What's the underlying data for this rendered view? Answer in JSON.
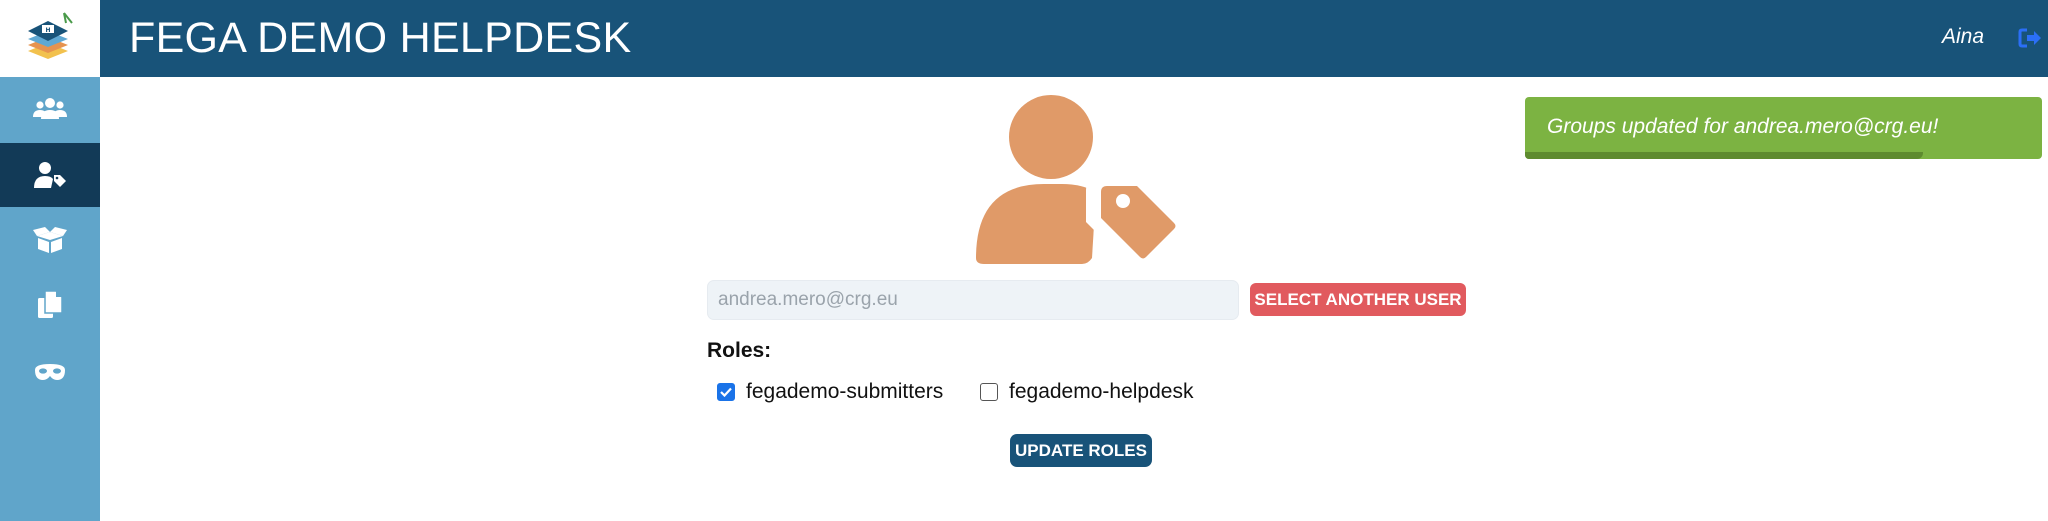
{
  "header": {
    "title": "FEGA DEMO HELPDESK",
    "user_name": "Aina"
  },
  "sidebar": {
    "items": [
      {
        "icon": "users-icon",
        "active": false
      },
      {
        "icon": "user-tag-icon",
        "active": true
      },
      {
        "icon": "open-box-icon",
        "active": false
      },
      {
        "icon": "copy-documents-icon",
        "active": false
      },
      {
        "icon": "mask-icon",
        "active": false
      }
    ]
  },
  "user_form": {
    "email_value": "andrea.mero@crg.eu",
    "select_user_label": "SELECT ANOTHER USER",
    "roles_label": "Roles:",
    "roles": [
      {
        "name": "fegademo-submitters",
        "checked": true
      },
      {
        "name": "fegademo-helpdesk",
        "checked": false
      }
    ],
    "update_label": "UPDATE ROLES"
  },
  "toast": {
    "message": "Groups updated for andrea.mero@crg.eu!",
    "progress": 0.77
  },
  "colors": {
    "header": "#185379",
    "sidebar": "#60a5ca",
    "sidebar_active": "#123a57",
    "accent_orange": "#e09a68",
    "danger": "#e15a5e",
    "success": "#7cb342"
  }
}
